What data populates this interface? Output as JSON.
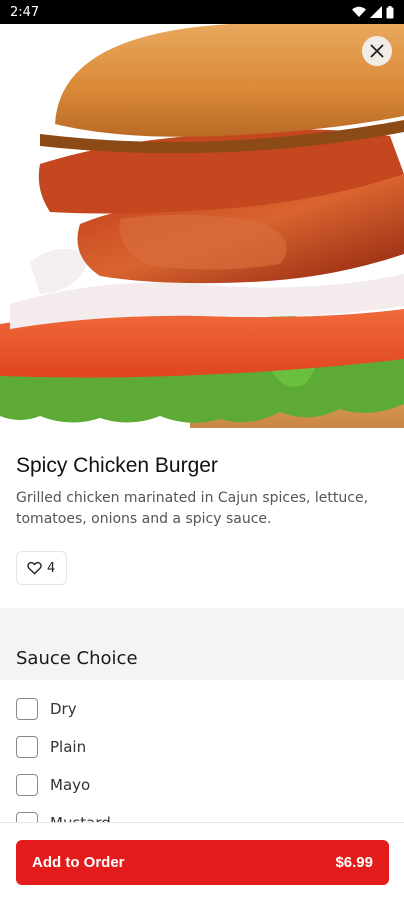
{
  "status_bar": {
    "time": "2:47",
    "icons": [
      "wifi-icon",
      "cell-signal-icon",
      "battery-icon"
    ]
  },
  "hero": {
    "image": "spicy-chicken-burger-photo",
    "close_icon": "close-icon"
  },
  "item": {
    "title": "Spicy Chicken Burger",
    "description": "Grilled chicken marinated in Cajun spices, lettuce, tomatoes, onions and a spicy sauce.",
    "like_icon": "heart-outline-icon",
    "like_count": "4"
  },
  "sauce": {
    "title": "Sauce Choice",
    "options": [
      {
        "label": "Dry",
        "checked": false
      },
      {
        "label": "Plain",
        "checked": false
      },
      {
        "label": "Mayo",
        "checked": false
      },
      {
        "label": "Mustard",
        "checked": false
      }
    ]
  },
  "order": {
    "label": "Add to Order",
    "price": "$6.99"
  },
  "colors": {
    "accent": "#e41b1b",
    "section_bg": "#f4f4f4"
  }
}
